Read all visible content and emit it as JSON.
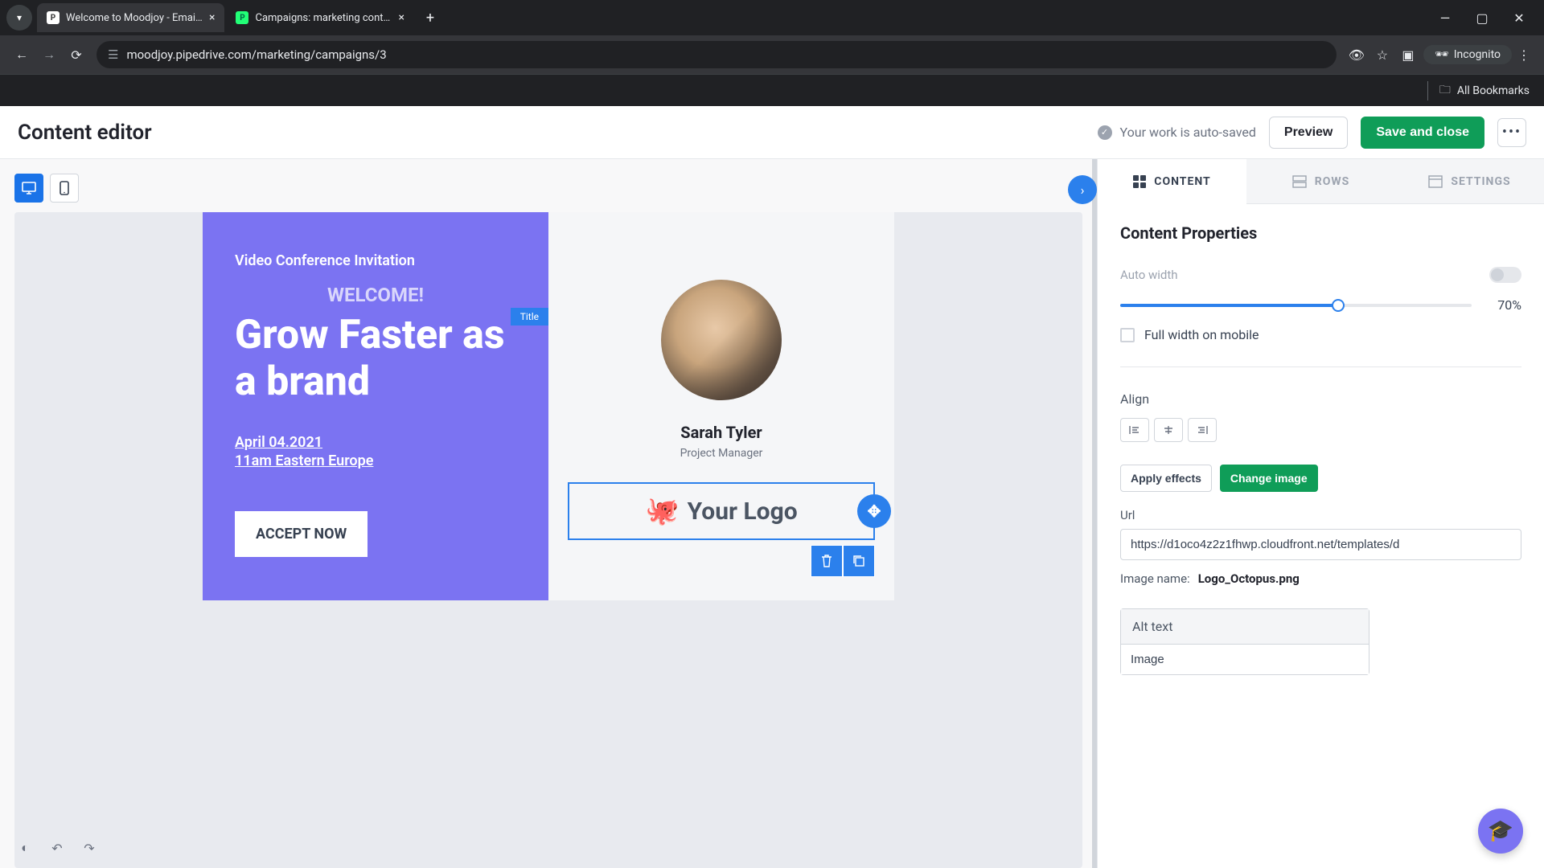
{
  "browser": {
    "tabs": [
      {
        "title": "Welcome to Moodjoy - Email c",
        "favicon": "P",
        "active": true
      },
      {
        "title": "Campaigns: marketing contacts",
        "favicon": "P",
        "active": false
      }
    ],
    "url": "moodjoy.pipedrive.com/marketing/campaigns/3",
    "incognito_label": "Incognito",
    "all_bookmarks": "All Bookmarks"
  },
  "header": {
    "title": "Content editor",
    "autosave": "Your work is auto-saved",
    "preview": "Preview",
    "save_close": "Save and close"
  },
  "canvas": {
    "left": {
      "eyebrow": "Video Conference Invitation",
      "welcome": "WELCOME!",
      "title_tag": "Title",
      "heading": "Grow Faster as a brand",
      "date": "April 04.2021",
      "time": "11am Eastern Europe",
      "cta": "ACCEPT NOW"
    },
    "right": {
      "name": "Sarah Tyler",
      "role": "Project Manager",
      "logo_text": "Your Logo"
    }
  },
  "sidebar": {
    "tabs": {
      "content": "CONTENT",
      "rows": "ROWS",
      "settings": "SETTINGS"
    },
    "panel_title": "Content Properties",
    "auto_width_label": "Auto width",
    "width_value": "70%",
    "full_width_mobile": "Full width on mobile",
    "align_label": "Align",
    "apply_effects": "Apply effects",
    "change_image": "Change image",
    "url_label": "Url",
    "url_value": "https://d1oco4z2z1fhwp.cloudfront.net/templates/d",
    "image_name_label": "Image name:",
    "image_name_value": "Logo_Octopus.png",
    "alt_text_label": "Alt text",
    "alt_text_value": "Image"
  }
}
